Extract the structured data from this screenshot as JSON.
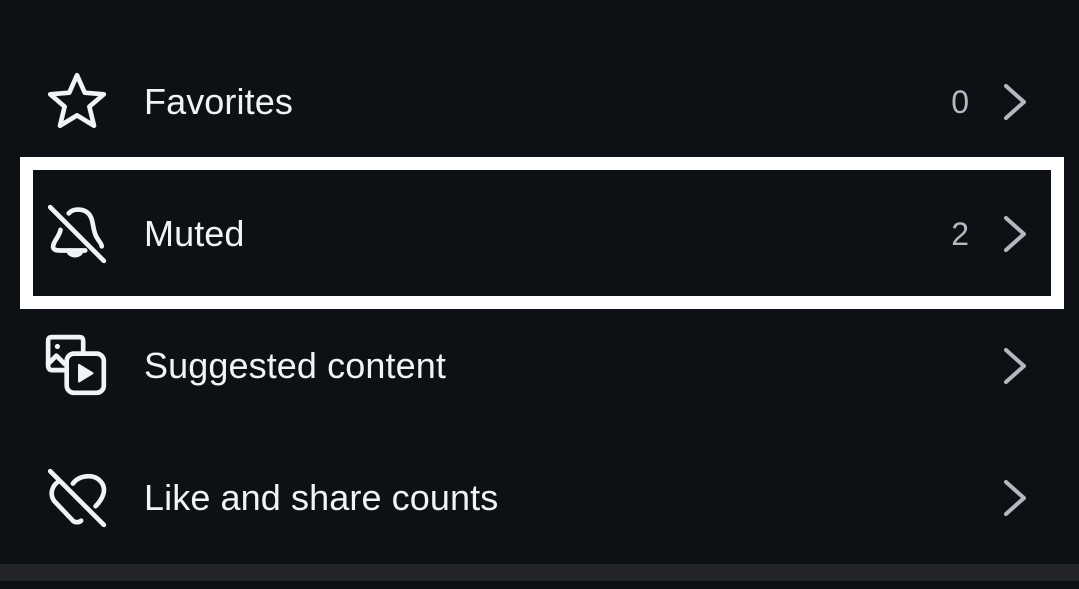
{
  "menu": {
    "items": [
      {
        "label": "Favorites",
        "count": "0",
        "icon": "star-icon"
      },
      {
        "label": "Muted",
        "count": "2",
        "icon": "bell-off-icon"
      },
      {
        "label": "Suggested content",
        "count": null,
        "icon": "media-icon"
      },
      {
        "label": "Like and share counts",
        "count": null,
        "icon": "heart-off-icon"
      }
    ]
  },
  "highlight": {
    "target": "Muted",
    "color": "#ffffff"
  },
  "colors": {
    "background": "#0d1015",
    "text": "#f2f3f5",
    "secondary": "#b5b9bf",
    "divider": "#222429"
  }
}
